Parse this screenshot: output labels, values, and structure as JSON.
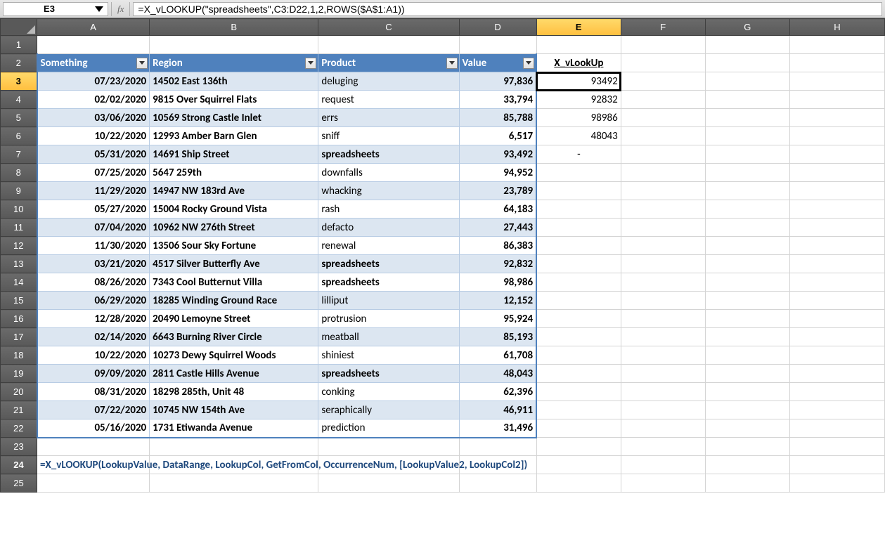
{
  "nameBox": "E3",
  "fxLabel": "fx",
  "formula": "=X_vLOOKUP(\"spreadsheets\",C3:D22,1,2,ROWS($A$1:A1))",
  "colHeaders": [
    "A",
    "B",
    "C",
    "D",
    "E",
    "F",
    "G",
    "H"
  ],
  "activeCol": "E",
  "activeRow": 3,
  "tableHeaders": {
    "A": "Something",
    "B": "Region",
    "C": "Product",
    "D": "Value"
  },
  "eHeader": "X_vLookUp",
  "rows": [
    {
      "r": 3,
      "a": "07/23/2020",
      "b": "14502 East 136th",
      "c": "deluging",
      "cBold": false,
      "d": "97,836",
      "e": "93492"
    },
    {
      "r": 4,
      "a": "02/02/2020",
      "b": "9815 Over Squirrel Flats",
      "c": "request",
      "cBold": false,
      "d": "33,794",
      "e": "92832"
    },
    {
      "r": 5,
      "a": "03/06/2020",
      "b": "10569 Strong Castle Inlet",
      "c": "errs",
      "cBold": false,
      "d": "85,788",
      "e": "98986"
    },
    {
      "r": 6,
      "a": "10/22/2020",
      "b": "12993 Amber Barn Glen",
      "c": "sniff",
      "cBold": false,
      "d": "6,517",
      "e": "48043"
    },
    {
      "r": 7,
      "a": "05/31/2020",
      "b": "14691 Ship Street",
      "c": "spreadsheets",
      "cBold": true,
      "d": "93,492",
      "e": "-",
      "eCenter": true
    },
    {
      "r": 8,
      "a": "07/25/2020",
      "b": "5647  259th",
      "c": "downfalls",
      "cBold": false,
      "d": "94,952",
      "e": ""
    },
    {
      "r": 9,
      "a": "11/29/2020",
      "b": "14947 NW 183rd Ave",
      "c": "whacking",
      "cBold": false,
      "d": "23,789",
      "e": ""
    },
    {
      "r": 10,
      "a": "05/27/2020",
      "b": "15004 Rocky Ground Vista",
      "c": "rash",
      "cBold": false,
      "d": "64,183",
      "e": ""
    },
    {
      "r": 11,
      "a": "07/04/2020",
      "b": "10962 NW 276th Street",
      "c": "defacto",
      "cBold": false,
      "d": "27,443",
      "e": ""
    },
    {
      "r": 12,
      "a": "11/30/2020",
      "b": "13506 Sour Sky Fortune",
      "c": "renewal",
      "cBold": false,
      "d": "86,383",
      "e": ""
    },
    {
      "r": 13,
      "a": "03/21/2020",
      "b": "4517 Silver Butterfly Ave",
      "c": "spreadsheets",
      "cBold": true,
      "d": "92,832",
      "e": ""
    },
    {
      "r": 14,
      "a": "08/26/2020",
      "b": "7343 Cool Butternut Villa",
      "c": "spreadsheets",
      "cBold": true,
      "d": "98,986",
      "e": ""
    },
    {
      "r": 15,
      "a": "06/29/2020",
      "b": "18285 Winding Ground Race",
      "c": "lilliput",
      "cBold": false,
      "d": "12,152",
      "e": ""
    },
    {
      "r": 16,
      "a": "12/28/2020",
      "b": "20490 Lemoyne Street",
      "c": "protrusion",
      "cBold": false,
      "d": "95,924",
      "e": ""
    },
    {
      "r": 17,
      "a": "02/14/2020",
      "b": "6643 Burning River Circle",
      "c": "meatball",
      "cBold": false,
      "d": "85,193",
      "e": ""
    },
    {
      "r": 18,
      "a": "10/22/2020",
      "b": "10273 Dewy Squirrel Woods",
      "c": "shiniest",
      "cBold": false,
      "d": "61,708",
      "e": ""
    },
    {
      "r": 19,
      "a": "09/09/2020",
      "b": "2811 Castle Hills Avenue",
      "c": "spreadsheets",
      "cBold": true,
      "d": "48,043",
      "e": ""
    },
    {
      "r": 20,
      "a": "08/31/2020",
      "b": "18298  285th,  Unit 48",
      "c": "conking",
      "cBold": false,
      "d": "62,396",
      "e": ""
    },
    {
      "r": 21,
      "a": "07/22/2020",
      "b": "10745 NW 154th Ave",
      "c": "seraphically",
      "cBold": false,
      "d": "46,911",
      "e": ""
    },
    {
      "r": 22,
      "a": "05/16/2020",
      "b": "1731 Etiwanda Avenue",
      "c": "prediction",
      "cBold": false,
      "d": "31,496",
      "e": ""
    }
  ],
  "syntaxHint": "=X_vLOOKUP(LookupValue, DataRange, LookupCol, GetFromCol, OccurrenceNum, [LookupValue2, LookupCol2])",
  "emptyRows": [
    1,
    23,
    25
  ],
  "syntaxRow": 24
}
